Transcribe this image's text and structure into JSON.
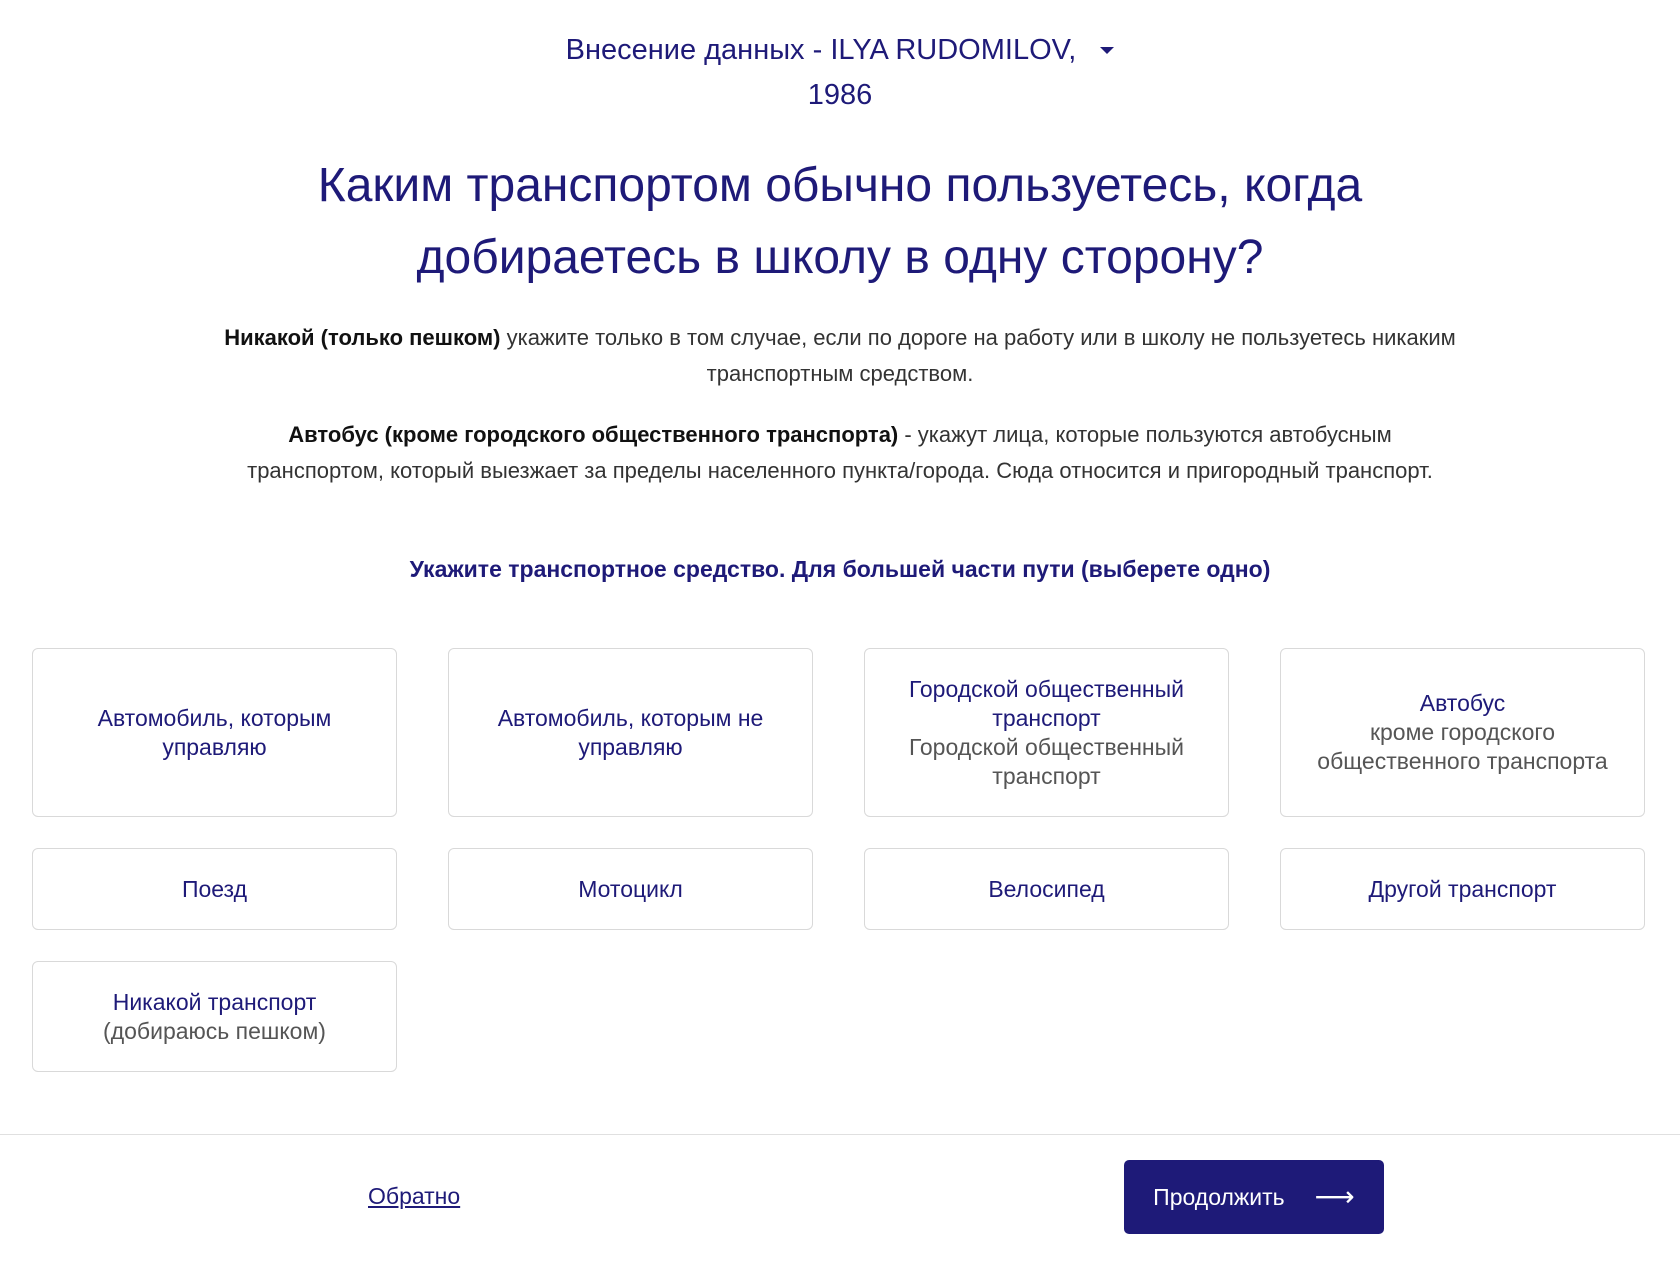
{
  "header": {
    "title_line1": "Внесение данных - ILYA RUDOMILOV,",
    "title_line2": "1986"
  },
  "question": {
    "line1": "Каким транспортом обычно пользуетесь, когда",
    "line2": "добираетесь в школу в одну сторону?"
  },
  "notes": {
    "note1_bold": "Никакой (только пешком)",
    "note1_text": " укажите только в том случае, если по дороге на работу или в школу не пользуетесь никаким транспортным средством.",
    "note2_bold": "Автобус (кроме городского общественного транспорта)",
    "note2_text": " - укажут лица, которые пользуются автобусным транспортом, который выезжает за пределы населенного пункта/города. Сюда относится и пригородный транспорт."
  },
  "instruction": "Укажите транспортное средство. Для большей части пути (выберете одно)",
  "options": [
    {
      "title": "Автомобиль, которым управляю",
      "sub": ""
    },
    {
      "title": "Автомобиль, которым не управляю",
      "sub": ""
    },
    {
      "title": "Городской общественный транспорт",
      "sub": "Городской общественный транспорт"
    },
    {
      "title": "Автобус",
      "sub": "кроме городского общественного транспорта"
    },
    {
      "title": "Поезд",
      "sub": ""
    },
    {
      "title": "Мотоцикл",
      "sub": ""
    },
    {
      "title": "Велосипед",
      "sub": ""
    },
    {
      "title": "Другой транспорт",
      "sub": ""
    },
    {
      "title": "Никакой транспорт",
      "sub": "(добираюсь пешком)"
    }
  ],
  "footer": {
    "back_label": "Обратно",
    "continue_label": "Продолжить",
    "continue_icon": "arrow-right-icon"
  },
  "colors": {
    "accent": "#1e1a78",
    "border": "#d9d9d9"
  }
}
